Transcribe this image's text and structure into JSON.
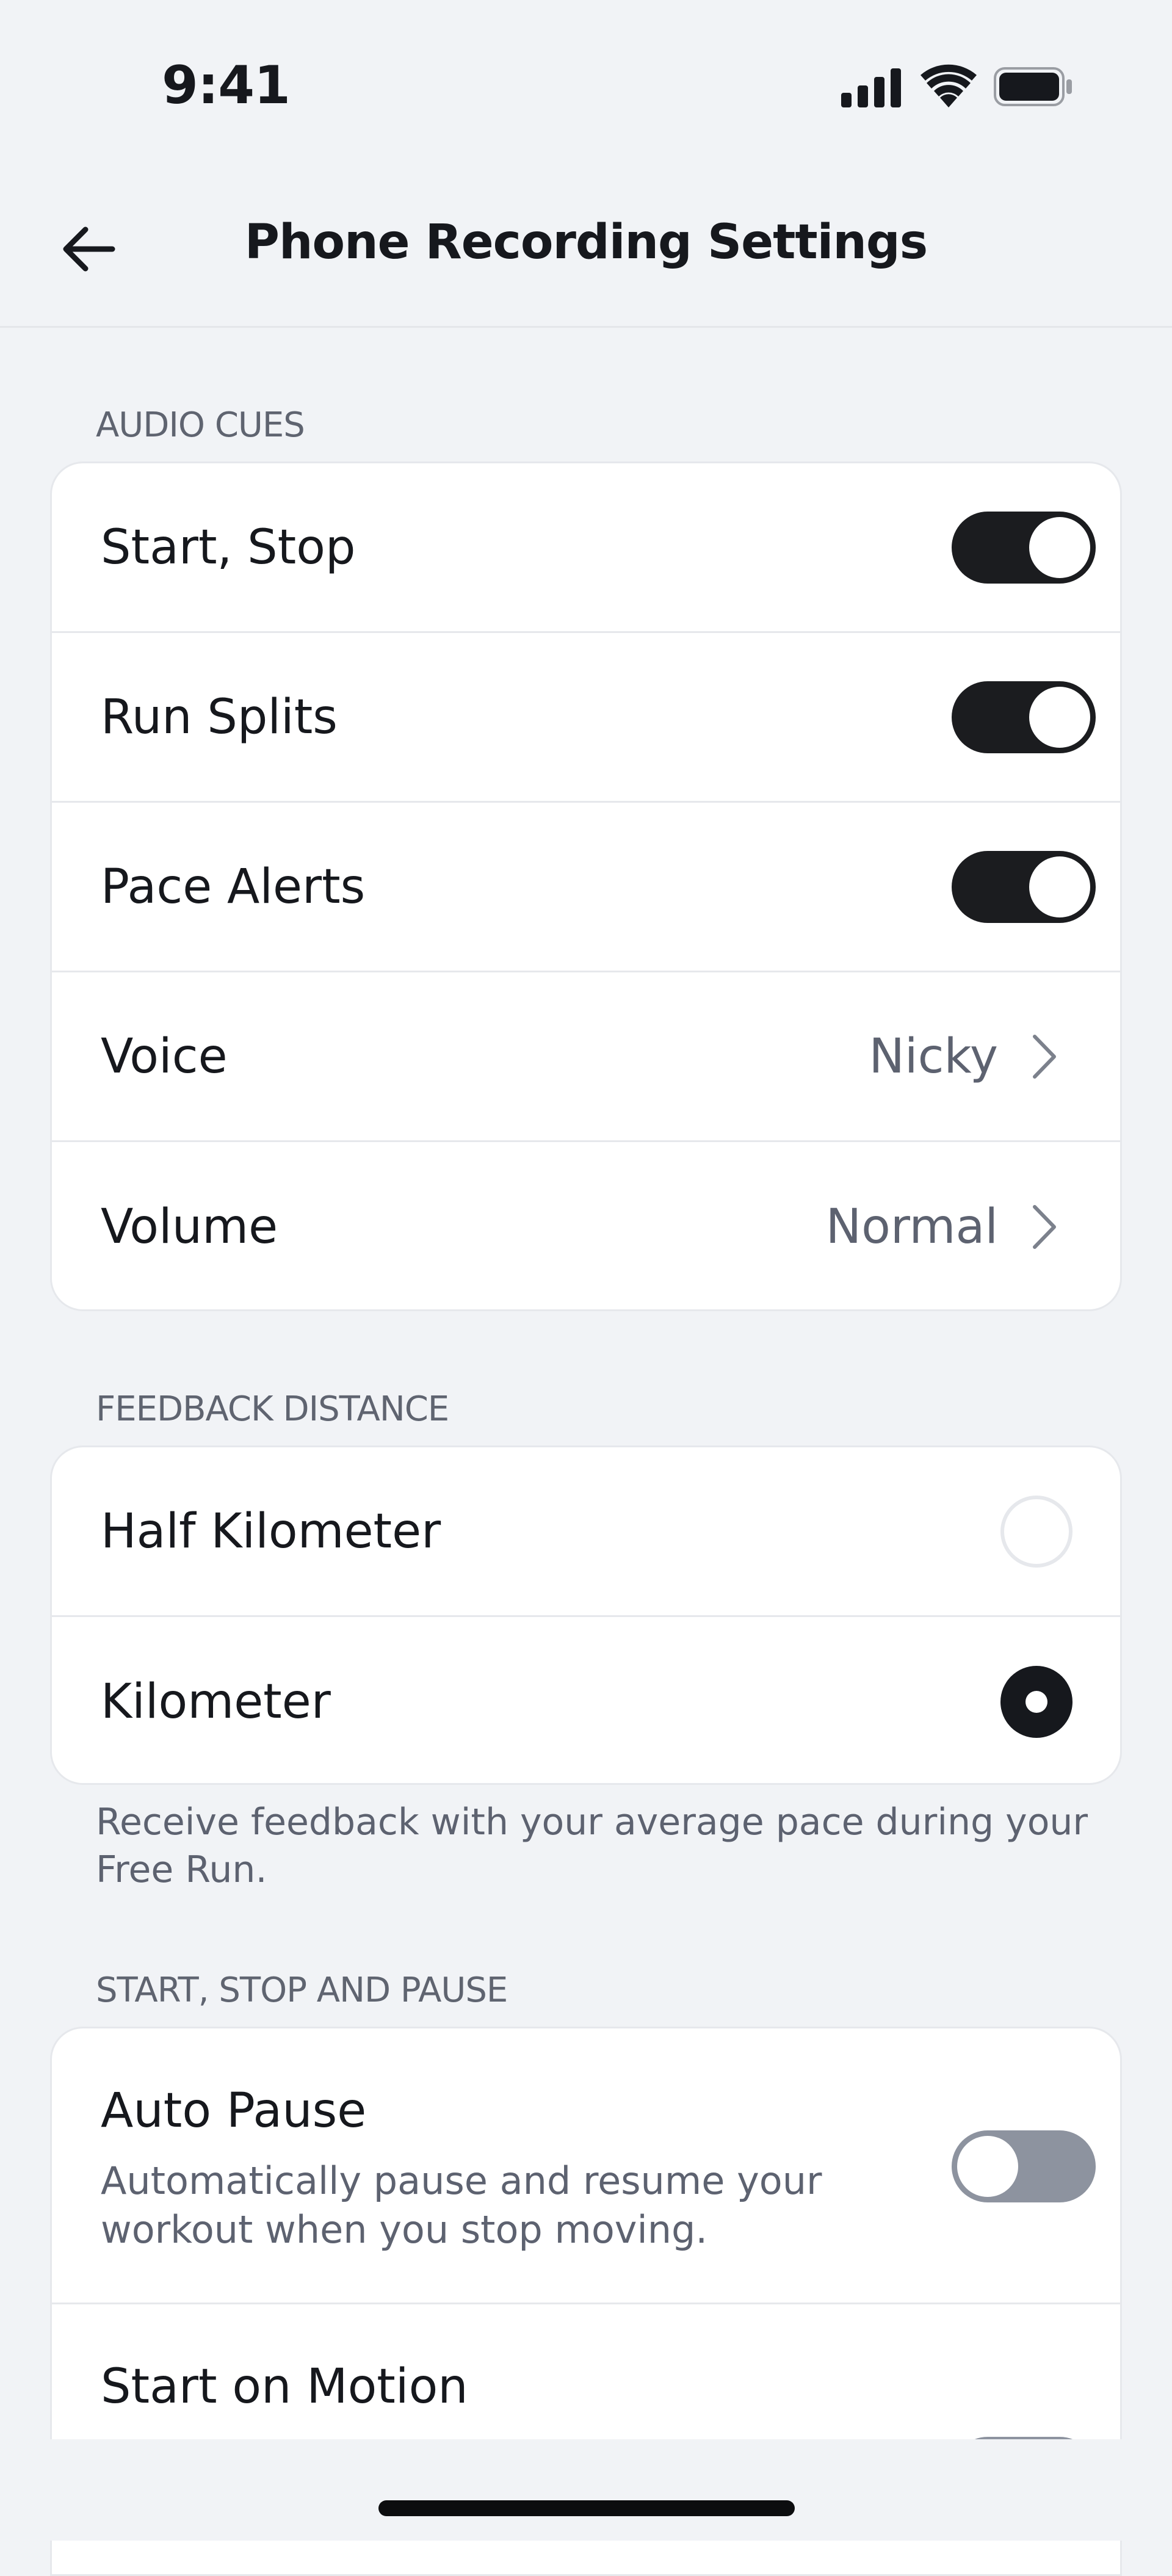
{
  "status_bar": {
    "time": "9:41"
  },
  "nav": {
    "title": "Phone Recording Settings"
  },
  "sections": {
    "audio_cues": {
      "header": "AUDIO CUES",
      "items": [
        {
          "label": "Start, Stop",
          "control": "toggle",
          "on": true
        },
        {
          "label": "Run Splits",
          "control": "toggle",
          "on": true
        },
        {
          "label": "Pace Alerts",
          "control": "toggle",
          "on": true
        },
        {
          "label": "Voice",
          "control": "disclosure",
          "value": "Nicky"
        },
        {
          "label": "Volume",
          "control": "disclosure",
          "value": "Normal"
        }
      ]
    },
    "feedback_distance": {
      "header": "FEEDBACK DISTANCE",
      "items": [
        {
          "label": "Half Kilometer",
          "selected": false
        },
        {
          "label": "Kilometer",
          "selected": true
        }
      ],
      "footnote": "Receive feedback with your average pace during your Free Run."
    },
    "start_stop_pause": {
      "header": "START, STOP AND PAUSE",
      "items": [
        {
          "label": "Auto Pause",
          "description": "Automatically pause and resume your workout when you stop moving.",
          "on": false
        },
        {
          "label": "Start on Motion",
          "on": false
        }
      ]
    }
  },
  "colors": {
    "background": "#f1f3f6",
    "card": "#ffffff",
    "toggle_on": "#1b1c1f",
    "toggle_off": "#8d939f",
    "secondary_text": "#5d6270"
  }
}
